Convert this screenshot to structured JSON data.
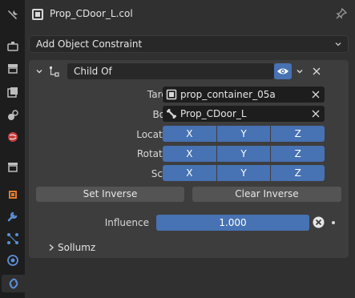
{
  "header": {
    "object_name": "Prop_CDoor_L.col"
  },
  "add_constraint": {
    "label": "Add Object Constraint"
  },
  "constraint": {
    "name": "Child Of",
    "target": {
      "label": "Target",
      "value": "prop_container_05a"
    },
    "bone": {
      "label": "Bone",
      "value": "Prop_CDoor_L"
    },
    "location": {
      "label": "Location",
      "axes": [
        "X",
        "Y",
        "Z"
      ]
    },
    "rotation": {
      "label": "Rotation",
      "axes": [
        "X",
        "Y",
        "Z"
      ]
    },
    "scale": {
      "label": "Scale",
      "axes": [
        "X",
        "Y",
        "Z"
      ]
    },
    "set_inverse_label": "Set Inverse",
    "clear_inverse_label": "Clear Inverse",
    "influence": {
      "label": "Influence",
      "value_text": "1.000",
      "value": 1.0
    }
  },
  "subpanel": {
    "label": "Sollumz"
  },
  "colors": {
    "accent": "#4772b3",
    "background": "#303030",
    "panel": "#3d3d3d",
    "tab_strip": "#1d1d1d"
  },
  "tabs": [
    {
      "icon": "tool-icon"
    },
    {
      "icon": "render-icon"
    },
    {
      "icon": "output-icon"
    },
    {
      "icon": "view-layer-icon"
    },
    {
      "icon": "scene-icon"
    },
    {
      "icon": "world-icon"
    },
    {
      "icon": "collection-icon"
    },
    {
      "icon": "object-icon"
    },
    {
      "icon": "modifier-icon"
    },
    {
      "icon": "particles-icon"
    },
    {
      "icon": "physics-icon"
    },
    {
      "icon": "constraint-icon"
    }
  ]
}
